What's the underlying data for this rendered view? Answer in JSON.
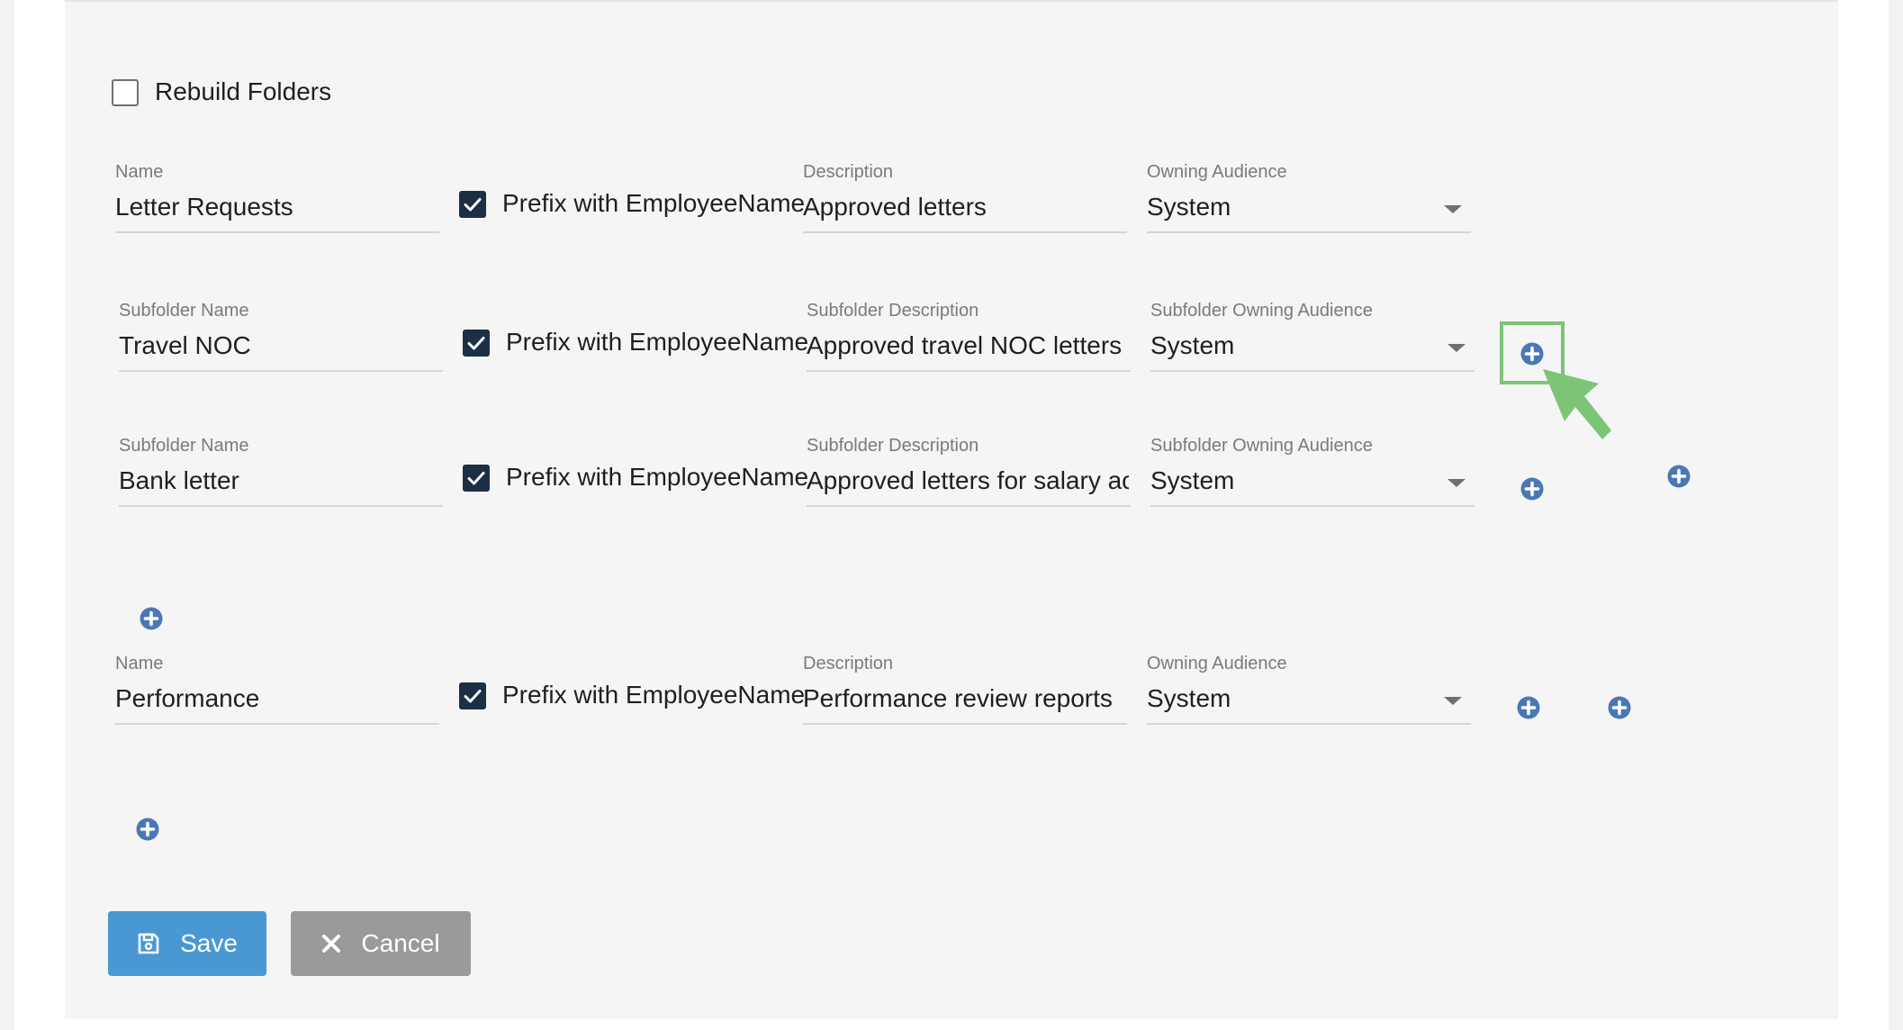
{
  "rebuild": {
    "label": "Rebuild Folders",
    "checked": false
  },
  "folders": [
    {
      "name_label": "Name",
      "name_value": "Letter Requests",
      "prefix_label": "Prefix with EmployeeName",
      "desc_label": "Description",
      "desc_value": "Approved letters",
      "aud_label": "Owning Audience",
      "aud_value": "System",
      "subfolders": [
        {
          "name_label": "Subfolder Name",
          "name_value": "Travel NOC",
          "prefix_label": "Prefix with EmployeeName",
          "desc_label": "Subfolder Description",
          "desc_value": "Approved travel NOC letters",
          "aud_label": "Subfolder Owning Audience",
          "aud_value": "System"
        },
        {
          "name_label": "Subfolder Name",
          "name_value": "Bank letter",
          "prefix_label": "Prefix with EmployeeName",
          "desc_label": "Subfolder Description",
          "desc_value": "Approved letters for salary acc",
          "aud_label": "Subfolder Owning Audience",
          "aud_value": "System"
        }
      ]
    },
    {
      "name_label": "Name",
      "name_value": "Performance",
      "prefix_label": "Prefix with EmployeeName",
      "desc_label": "Description",
      "desc_value": "Performance review reports",
      "aud_label": "Owning Audience",
      "aud_value": "System"
    }
  ],
  "actions": {
    "save_label": "Save",
    "cancel_label": "Cancel"
  },
  "icons": {
    "add": "plus-circle-icon",
    "save": "floppy-disk-icon",
    "cancel": "x-icon",
    "dropdown": "caret-down-icon",
    "pointer": "cursor-arrow-icon"
  },
  "colors": {
    "primary": "#4a98d2",
    "secondary": "#9a9a9a",
    "checkbox": "#1d2f45",
    "add_icon": "#4a78b5",
    "highlight": "#7cc576"
  }
}
